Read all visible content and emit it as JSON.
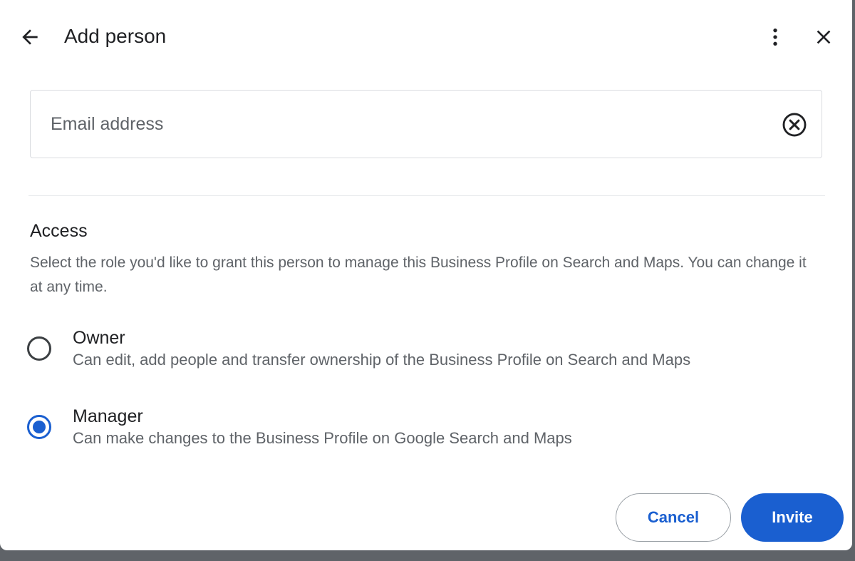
{
  "dialog": {
    "title": "Add person",
    "back_icon": "arrow-back-icon",
    "more_icon": "more-vert-icon",
    "close_icon": "close-icon"
  },
  "email": {
    "value": "",
    "placeholder": "Email address",
    "clear_icon": "clear-circle-icon"
  },
  "access": {
    "title": "Access",
    "description": "Select the role you'd like to grant this person to manage this Business Profile on Search and Maps. You can change it at any time.",
    "roles": [
      {
        "name": "Owner",
        "description": "Can edit, add people and transfer ownership of the Business Profile on Search and Maps",
        "selected": false
      },
      {
        "name": "Manager",
        "description": "Can make changes to the Business Profile on Google Search and Maps",
        "selected": true
      }
    ]
  },
  "actions": {
    "cancel_label": "Cancel",
    "invite_label": "Invite"
  },
  "colors": {
    "accent": "#1a5fd0",
    "text_primary": "#202124",
    "text_secondary": "#5f6368"
  }
}
